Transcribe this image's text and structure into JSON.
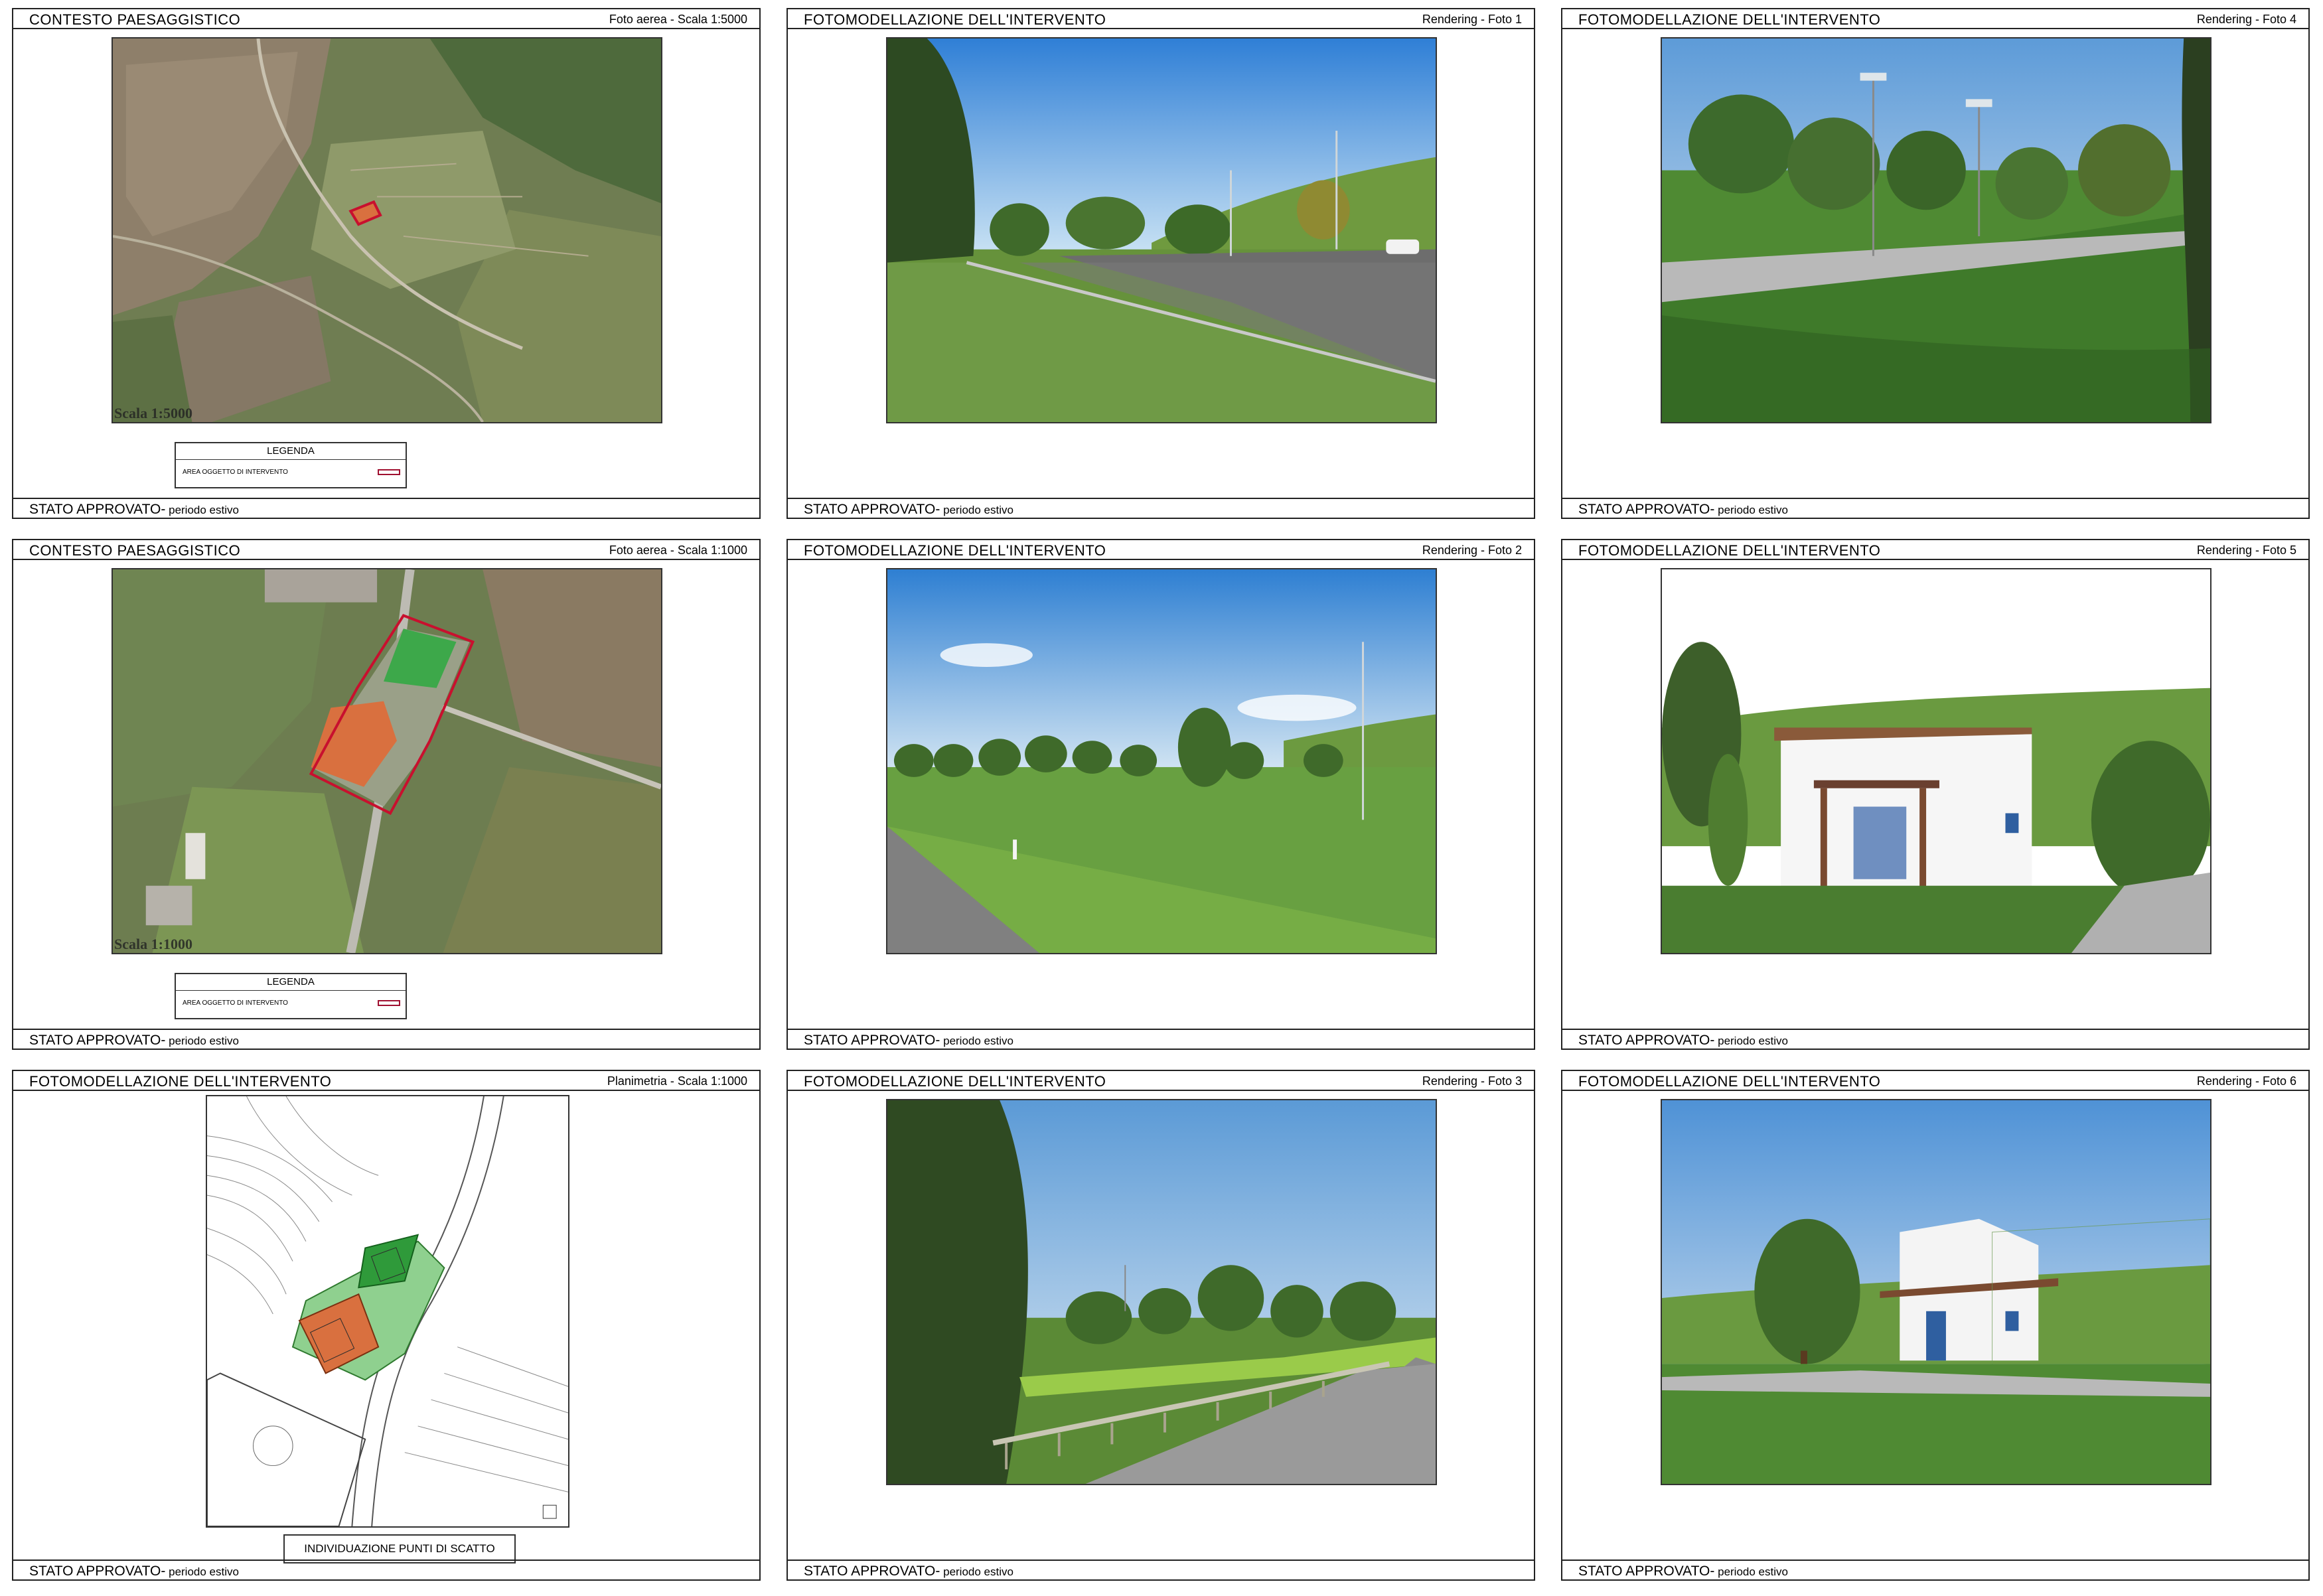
{
  "panels": [
    {
      "title": "CONTESTO PAESAGGISTICO",
      "scale": "Foto aerea - Scala 1:5000",
      "footer": "STATO APPROVATO-",
      "footer_sub": " periodo estivo",
      "image_label": "Scala 1:5000",
      "legend": {
        "title": "LEGENDA",
        "item": "AREA OGGETTO DI INTERVENTO"
      }
    },
    {
      "title": "FOTOMODELLAZIONE DELL'INTERVENTO",
      "scale": "Rendering - Foto 1",
      "footer": "STATO APPROVATO-",
      "footer_sub": " periodo estivo"
    },
    {
      "title": "FOTOMODELLAZIONE DELL'INTERVENTO",
      "scale": "Rendering - Foto 4",
      "footer": "STATO APPROVATO-",
      "footer_sub": " periodo estivo"
    },
    {
      "title": "CONTESTO PAESAGGISTICO",
      "scale": "Foto aerea - Scala 1:1000",
      "footer": "STATO APPROVATO-",
      "footer_sub": " periodo estivo",
      "image_label": "Scala 1:1000",
      "legend": {
        "title": "LEGENDA",
        "item": "AREA OGGETTO DI INTERVENTO"
      }
    },
    {
      "title": "FOTOMODELLAZIONE DELL'INTERVENTO",
      "scale": "Rendering - Foto 2",
      "footer": "STATO APPROVATO-",
      "footer_sub": " periodo estivo"
    },
    {
      "title": "FOTOMODELLAZIONE DELL'INTERVENTO",
      "scale": "Rendering - Foto 5",
      "footer": "STATO APPROVATO-",
      "footer_sub": " periodo estivo"
    },
    {
      "title": "FOTOMODELLAZIONE DELL'INTERVENTO",
      "scale": "Planimetria - Scala 1:1000",
      "footer": "STATO APPROVATO-",
      "footer_sub": " periodo estivo",
      "button": "INDIVIDUAZIONE PUNTI DI SCATTO"
    },
    {
      "title": "FOTOMODELLAZIONE DELL'INTERVENTO",
      "scale": "Rendering - Foto 3",
      "footer": "STATO APPROVATO-",
      "footer_sub": " periodo estivo"
    },
    {
      "title": "FOTOMODELLAZIONE DELL'INTERVENTO",
      "scale": "Rendering - Foto 6",
      "footer": "STATO APPROVATO-",
      "footer_sub": " periodo estivo"
    }
  ],
  "colors": {
    "frame": "#222222",
    "legend_swatch": "#a01030",
    "tennis_clay": "#d9703f",
    "tennis_green": "#2f9a3a"
  }
}
